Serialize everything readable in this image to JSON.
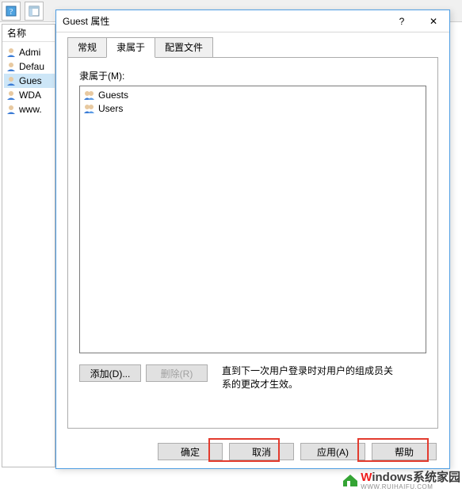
{
  "bg_toolbar": {
    "help_icon": "help-icon",
    "pane_icon": "pane-icon"
  },
  "bg_list": {
    "column_header": "名称",
    "items": [
      {
        "label": "Admi"
      },
      {
        "label": "Defau"
      },
      {
        "label": "Gues",
        "selected": true
      },
      {
        "label": "WDA"
      },
      {
        "label": "www."
      }
    ]
  },
  "dialog": {
    "title": "Guest 属性",
    "help": "?",
    "close": "✕",
    "tabs": [
      {
        "label": "常规",
        "active": false
      },
      {
        "label": "隶属于",
        "active": true
      },
      {
        "label": "配置文件",
        "active": false
      }
    ],
    "member_of_label": "隶属于(M):",
    "groups": [
      {
        "label": "Guests"
      },
      {
        "label": "Users"
      }
    ],
    "add_btn": "添加(D)...",
    "remove_btn": "删除(R)",
    "hint": "直到下一次用户登录时对用户的组成员关系的更改才生效。",
    "hint_line1": "直到下一次用户登录时对用户的组成员关",
    "hint_line2": "系的更改才生效。",
    "ok_btn": "确定",
    "cancel_btn": "取消",
    "apply_btn": "应用(A)",
    "help_btn": "帮助"
  },
  "watermark": {
    "text_main": "indows系统家园",
    "text_sub": "WWW.RUIHAIFU.COM"
  }
}
